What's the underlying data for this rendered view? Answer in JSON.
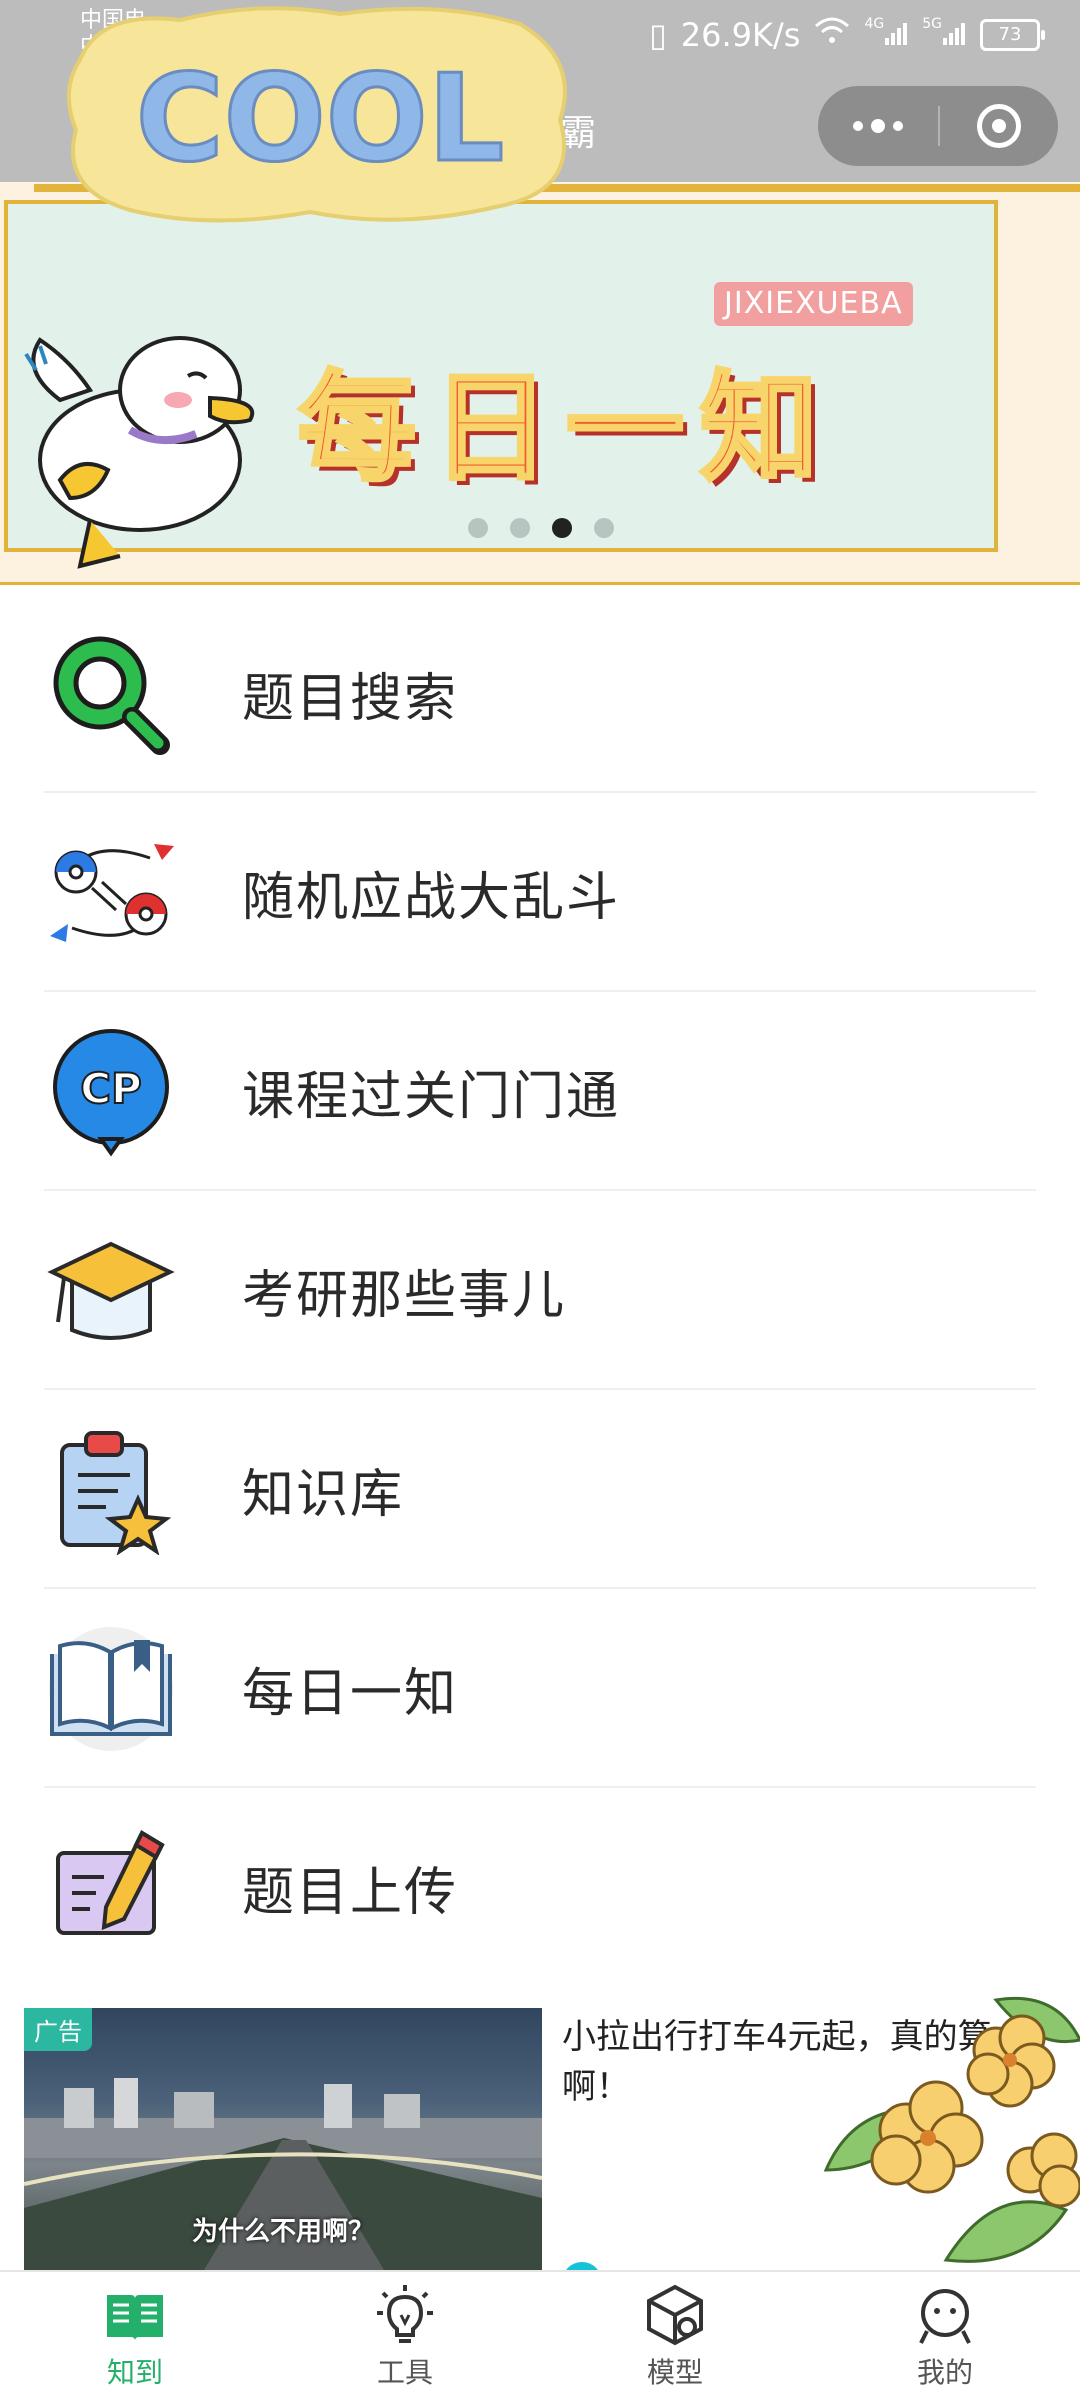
{
  "status_bar": {
    "carrier_line1": "中国电",
    "carrier_line2": "中国",
    "net_speed": "26.9K/s",
    "signal_1": "4G",
    "signal_2": "5G",
    "battery": "73"
  },
  "title_bar": {
    "title_fragment": "霸",
    "more_icon": "more-dots-icon",
    "close_icon": "target-circle-icon"
  },
  "banner": {
    "sticker_text": "COOL",
    "brand_tag": "JIXIEXUEBA",
    "headline": "每日一知",
    "carousel_count": 4,
    "carousel_active_index": 3
  },
  "menu": {
    "items": [
      {
        "label": "题目搜索",
        "icon": "search-magnifier-icon"
      },
      {
        "label": "随机应战大乱斗",
        "icon": "battle-swap-icon"
      },
      {
        "label": "课程过关门门通",
        "icon": "cp-bubble-icon"
      },
      {
        "label": "考研那些事儿",
        "icon": "graduation-cap-icon"
      },
      {
        "label": "知识库",
        "icon": "clipboard-star-icon"
      },
      {
        "label": "每日一知",
        "icon": "open-book-icon"
      },
      {
        "label": "题目上传",
        "icon": "pencil-note-icon"
      }
    ]
  },
  "ad": {
    "badge": "广告",
    "video_caption": "为什么不用啊？",
    "title": "小拉出行打车4元起，真的算啊！"
  },
  "tabbar": {
    "items": [
      {
        "label": "知到",
        "icon": "book-icon",
        "active": true
      },
      {
        "label": "工具",
        "icon": "lightbulb-icon",
        "active": false
      },
      {
        "label": "模型",
        "icon": "cube-icon",
        "active": false
      },
      {
        "label": "我的",
        "icon": "profile-icon",
        "active": false
      }
    ]
  },
  "colors": {
    "accent": "#24b06a",
    "titlebar": "#bcbcbc",
    "banner_frame": "#e0b33b"
  }
}
